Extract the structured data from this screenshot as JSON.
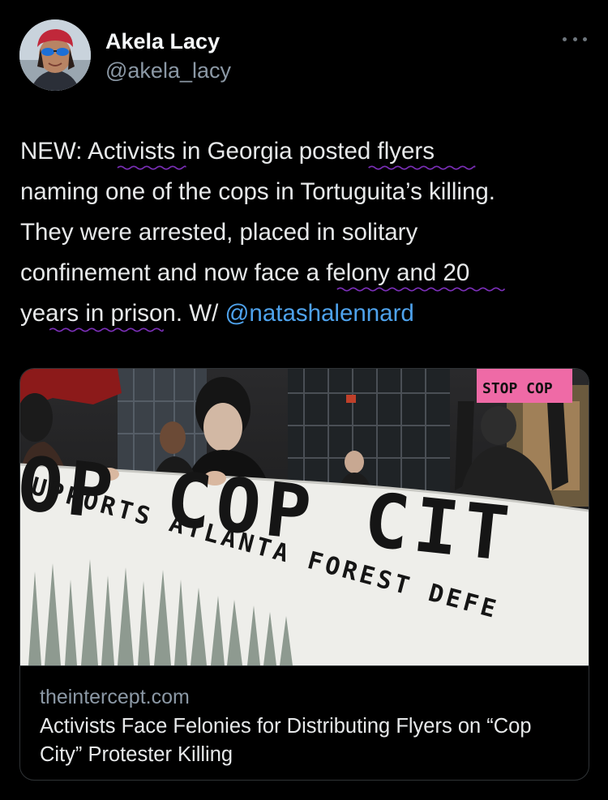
{
  "author": {
    "name": "Akela Lacy",
    "handle": "@akela_lacy",
    "avatar_icon": "profile-photo"
  },
  "more_icon": "ellipsis-horizontal-icon",
  "tweet": {
    "lines": [
      [
        "NEW: ",
        "Activists",
        " in Georgia ",
        "posted flyers"
      ],
      [
        "naming one of the cops in Tortuguita’s killing."
      ],
      [
        "They were arrested, placed in solitary"
      ],
      [
        "confinement and now ",
        "face a felony and 20"
      ],
      [
        "years in prison",
        ". W/ "
      ]
    ],
    "mention": "@natashalennard",
    "highlight_color": "#7b2fb8"
  },
  "card": {
    "image_description_icon": "protest-banner-photo",
    "banner_main_text": "OP COP CIT",
    "banner_sub_text": "UPPORTS ATLANTA FOREST DEFE",
    "sign_text": "STOP COP",
    "domain": "theintercept.com",
    "title": "Activists Face Felonies for Distributing Flyers on “Cop City” Protester Killing"
  },
  "colors": {
    "background": "#000000",
    "text": "#e7e9ea",
    "secondary": "#8b98a5",
    "link": "#4ea2ec",
    "border": "#2f3336"
  }
}
